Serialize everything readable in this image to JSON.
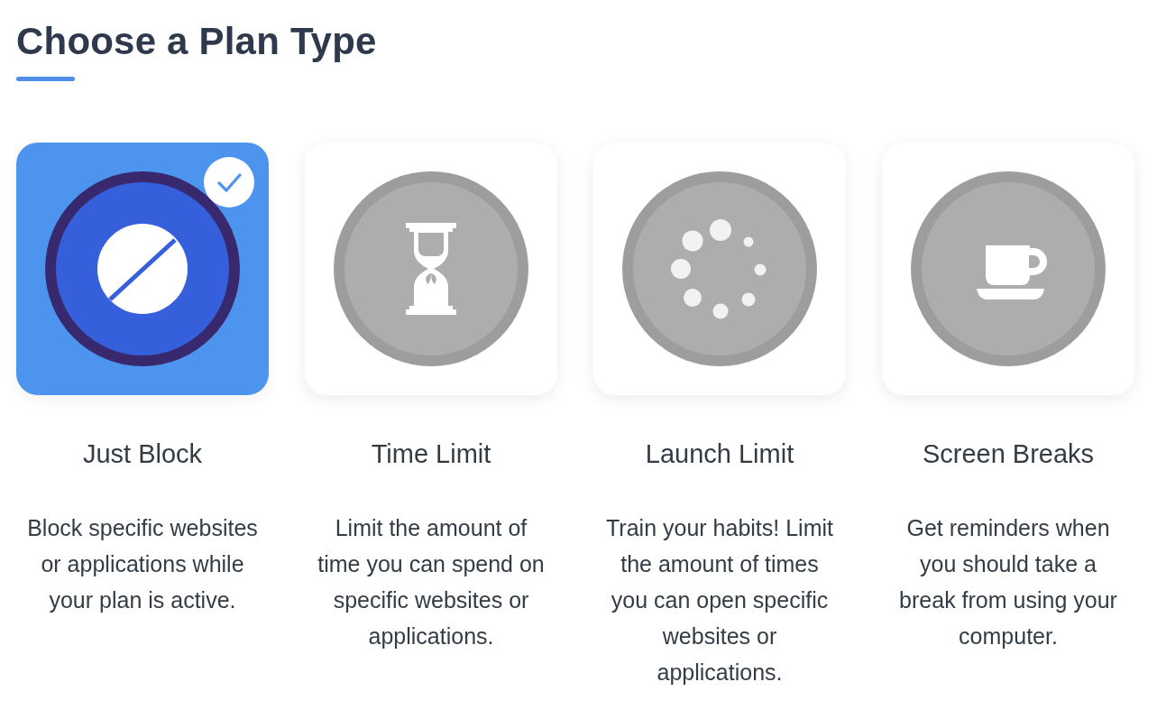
{
  "title": "Choose a Plan Type",
  "plans": [
    {
      "kind": "block",
      "name": "Just Block",
      "description": "Block specific websites or applications while your plan is active.",
      "selected": true
    },
    {
      "kind": "hourglass",
      "name": "Time Limit",
      "description": "Limit the amount of time you can spend on specific websites or applications.",
      "selected": false
    },
    {
      "kind": "dots",
      "name": "Launch Limit",
      "description": "Train your habits! Limit the amount of times you can open specific websites or applications.",
      "selected": false
    },
    {
      "kind": "cup",
      "name": "Screen Breaks",
      "description": "Get reminders when you should take a break from using your computer.",
      "selected": false
    }
  ]
}
